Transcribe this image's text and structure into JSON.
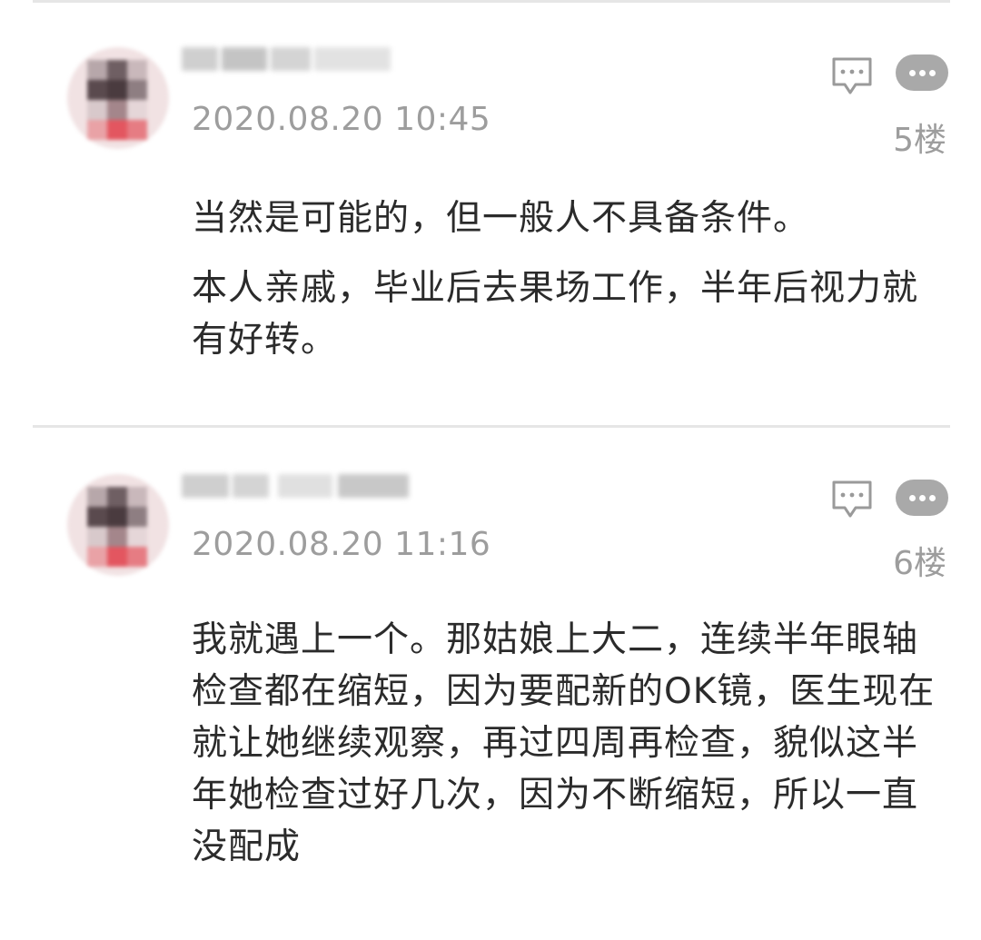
{
  "comments": [
    {
      "timestamp": "2020.08.20 10:45",
      "floor": "5楼",
      "paragraphs": [
        "当然是可能的，但一般人不具备条件。",
        "本人亲戚，毕业后去果场工作，半年后视力就有好转。"
      ],
      "icons": [
        "reply-icon",
        "more-icon"
      ]
    },
    {
      "timestamp": "2020.08.20 11:16",
      "floor": "6楼",
      "paragraphs": [
        "我就遇上一个。那姑娘上大二，连续半年眼轴检查都在缩短，因为要配新的OK镜，医生现在就让她继续观察，再过四周再检查，貌似这半年她检查过好几次，因为不断缩短，所以一直没配成"
      ],
      "icons": [
        "reply-icon",
        "more-icon"
      ]
    }
  ],
  "colors": {
    "text": "#2b2b2b",
    "meta": "#9d9d9d",
    "divider": "#e6e6e6",
    "more_button": "#a9a9a9"
  }
}
